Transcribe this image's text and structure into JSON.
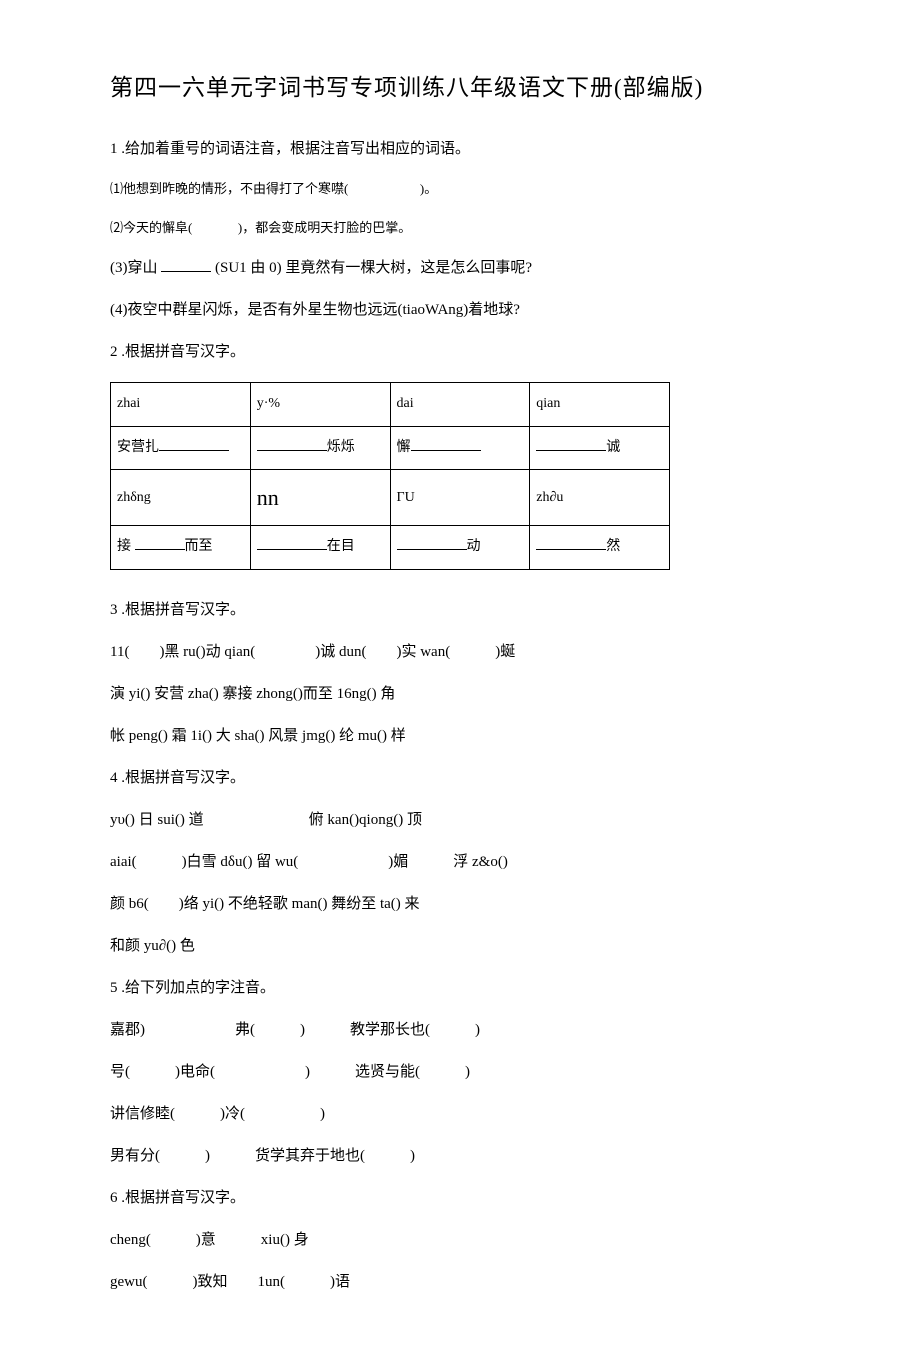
{
  "title": "第四一六单元字词书写专项训练八年级语文下册(部编版)",
  "q1": {
    "num": "1",
    "prompt": ".给加着重号的词语注音，根据注音写出相应的词语。",
    "sub1_a": "⑴他想到昨晚的情形，不由得打了个寒噤(",
    "sub1_b": ")。",
    "sub2_a": "⑵今天的懈阜(",
    "sub2_b": ")，都会变成明天打脸的巴掌。",
    "sub3_a": "(3)穿山",
    "sub3_b": "(SU1 由 0) 里竟然有一棵大树，这是怎么回事呢?",
    "sub4": "(4)夜空中群星闪烁，是否有外星生物也远远(tiaoWAng)着地球?"
  },
  "q2": {
    "num": "2",
    "prompt": ".根据拼音写汉字。",
    "table": {
      "r1": [
        "zhai",
        "y·%",
        "dai",
        "qian"
      ],
      "r2": {
        "c1_a": "安营扎",
        "c2_b": "烁烁",
        "c3_a": "懈",
        "c4_b": "诚"
      },
      "r3": [
        "zhδng",
        "nn",
        "ΓU",
        "zh∂u"
      ],
      "r4": {
        "c1_a": "接",
        "c1_b": "而至",
        "c2_b": "在目",
        "c3_b": "动",
        "c4_b": "然"
      }
    }
  },
  "q3": {
    "num": "3",
    "prompt": ".根据拼音写汉字。",
    "l1": "11(　　)黑 ru()动 qian(　　　　)诚 dun(　　)实 wan(　　　)蜒",
    "l2": "演 yi() 安营 zha() 寨接 zhong()而至 16ng() 角",
    "l3": "帐 peng() 霜 1i() 大 sha() 风景 jmg() 纶 mu() 样"
  },
  "q4": {
    "num": "4",
    "prompt": ".根据拼音写汉字。",
    "l1": "yυ() 日 sui() 道　　　　　　　俯 kan()qiong() 顶",
    "l2": "aiai(　　　)白雪 dδu() 留 wu(　　　　　　)媚　　　浮 z&o()",
    "l3": "颜 b6(　　)络 yi() 不绝轻歌 man() 舞纷至 ta() 来",
    "l4": "和颜 yu∂() 色"
  },
  "q5": {
    "num": "5",
    "prompt": ".给下列加点的字注音。",
    "l1": "嘉郡)　　　　　　弗(　　　)　　　教学那长也(　　　)",
    "l2": "号(　　　)电命(　　　　　　)　　　选贤与能(　　　)",
    "l3": "讲信修睦(　　　)冷(　　　　　)",
    "l4": "男有分(　　　)　　　货学其弃于地也(　　　)"
  },
  "q6": {
    "num": "6",
    "prompt": ".根据拼音写汉字。",
    "l1": "cheng(　　　)意　　　xiu() 身",
    "l2": "gewu(　　　)致知　　1un(　　　)语"
  }
}
